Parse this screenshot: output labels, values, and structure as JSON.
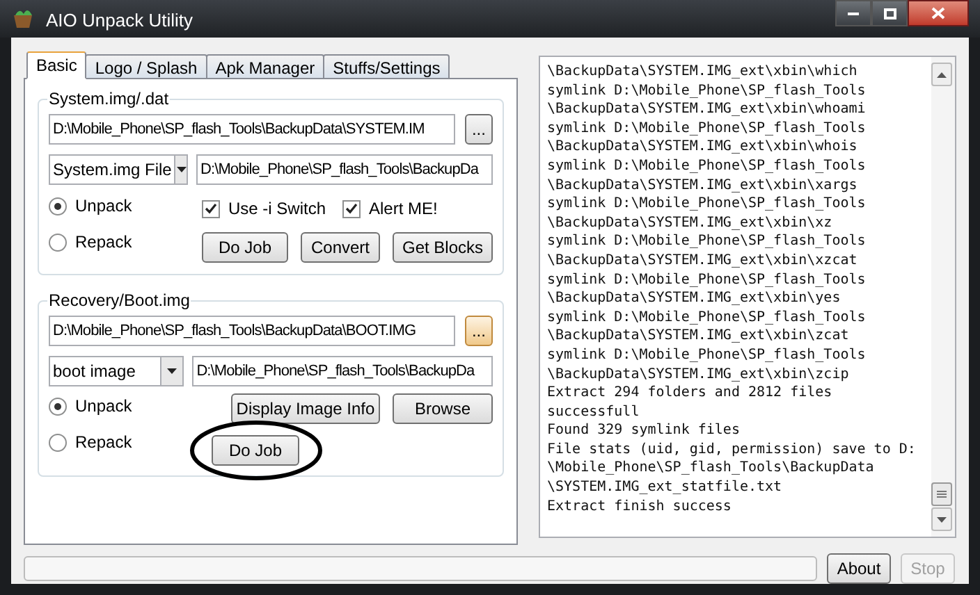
{
  "window": {
    "title": "AIO Unpack Utility"
  },
  "tabs": [
    {
      "label": "Basic",
      "selected": true
    },
    {
      "label": "Logo / Splash",
      "selected": false
    },
    {
      "label": "Apk Manager",
      "selected": false
    },
    {
      "label": "Stuffs/Settings",
      "selected": false
    }
  ],
  "system_group": {
    "title": "System.img/.dat",
    "path": "D:\\Mobile_Phone\\SP_flash_Tools\\BackupData\\SYSTEM.IM",
    "browse_button": "...",
    "type_select": "System.img File",
    "output_path": "D:\\Mobile_Phone\\SP_flash_Tools\\BackupDa",
    "radios": [
      {
        "label": "Unpack",
        "selected": true
      },
      {
        "label": "Repack",
        "selected": false
      }
    ],
    "checkboxes": [
      {
        "label": "Use -i Switch",
        "checked": true
      },
      {
        "label": "Alert ME!",
        "checked": true
      }
    ],
    "buttons": [
      "Do Job",
      "Convert",
      "Get Blocks"
    ]
  },
  "boot_group": {
    "title": "Recovery/Boot.img",
    "path": "D:\\Mobile_Phone\\SP_flash_Tools\\BackupData\\BOOT.IMG",
    "browse_button": "...",
    "type_select": "boot image",
    "output_path": "D:\\Mobile_Phone\\SP_flash_Tools\\BackupDa",
    "radios": [
      {
        "label": "Unpack",
        "selected": true
      },
      {
        "label": "Repack",
        "selected": false
      }
    ],
    "buttons": [
      "Display Image Info",
      "Browse"
    ],
    "job_button": "Do Job"
  },
  "log": [
    "\\BackupData\\SYSTEM.IMG_ext\\xbin\\which",
    "symlink D:\\Mobile_Phone\\SP_flash_Tools",
    "\\BackupData\\SYSTEM.IMG_ext\\xbin\\whoami",
    "symlink D:\\Mobile_Phone\\SP_flash_Tools",
    "\\BackupData\\SYSTEM.IMG_ext\\xbin\\whois",
    "symlink D:\\Mobile_Phone\\SP_flash_Tools",
    "\\BackupData\\SYSTEM.IMG_ext\\xbin\\xargs",
    "symlink D:\\Mobile_Phone\\SP_flash_Tools",
    "\\BackupData\\SYSTEM.IMG_ext\\xbin\\xz",
    "symlink D:\\Mobile_Phone\\SP_flash_Tools",
    "\\BackupData\\SYSTEM.IMG_ext\\xbin\\xzcat",
    "symlink D:\\Mobile_Phone\\SP_flash_Tools",
    "\\BackupData\\SYSTEM.IMG_ext\\xbin\\yes",
    "symlink D:\\Mobile_Phone\\SP_flash_Tools",
    "\\BackupData\\SYSTEM.IMG_ext\\xbin\\zcat",
    "symlink D:\\Mobile_Phone\\SP_flash_Tools",
    "\\BackupData\\SYSTEM.IMG_ext\\xbin\\zcip",
    "Extract 294 folders and 2812 files",
    "successfull",
    "Found 329 symlink files",
    "File stats (uid, gid, permission) save to D:",
    "\\Mobile_Phone\\SP_flash_Tools\\BackupData",
    "\\SYSTEM.IMG_ext_statfile.txt",
    "Extract finish success"
  ],
  "progress": {
    "level": 0
  },
  "footer_buttons": [
    {
      "label": "About",
      "disabled": false
    },
    {
      "label": "Stop",
      "disabled": true
    }
  ]
}
